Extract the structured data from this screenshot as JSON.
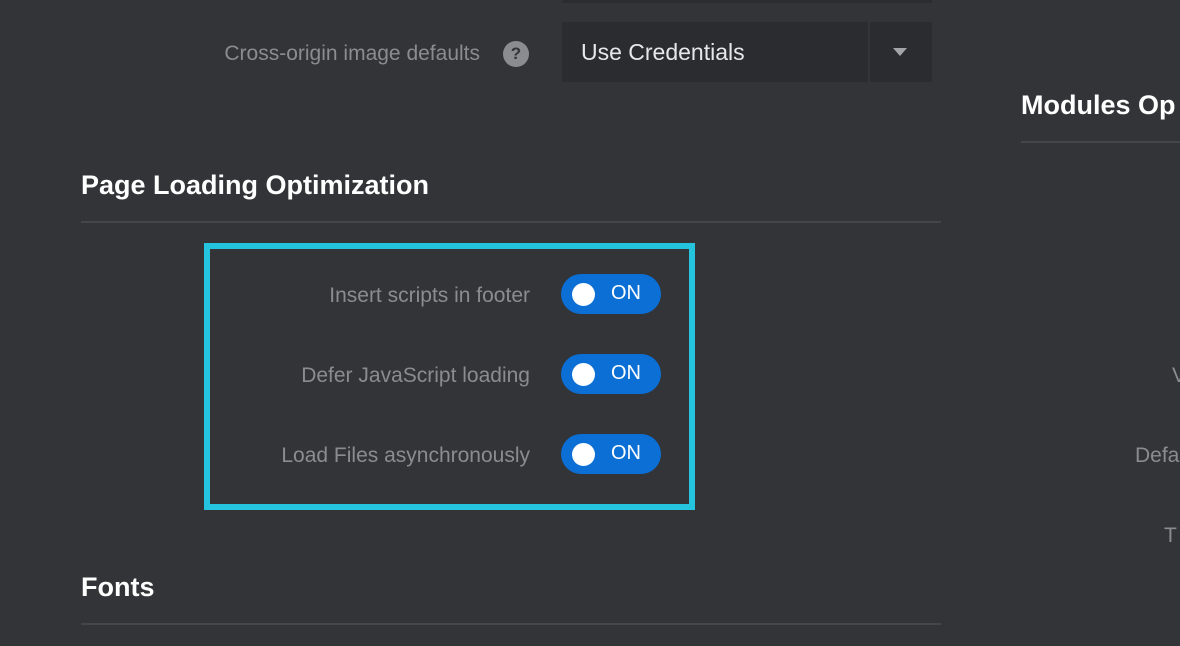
{
  "cross_origin": {
    "label": "Cross-origin image defaults",
    "help_glyph": "?",
    "value": "Use Credentials"
  },
  "page_loading": {
    "heading": "Page Loading Optimization",
    "rows": [
      {
        "label": "Insert scripts in footer",
        "state": "ON"
      },
      {
        "label": "Defer JavaScript loading",
        "state": "ON"
      },
      {
        "label": "Load Files asynchronously",
        "state": "ON"
      }
    ]
  },
  "fonts": {
    "heading": "Fonts"
  },
  "right_panel": {
    "heading": "Modules Op",
    "labels": [
      "V",
      "Defa",
      "T"
    ]
  },
  "colors": {
    "background": "#333438",
    "field": "#2b2c2f",
    "toggle_on": "#0b6fd6",
    "highlight": "#24c3de",
    "muted_text": "#8a8c90"
  },
  "icons": {
    "help": "question-circle-icon",
    "caret": "caret-down-icon"
  }
}
